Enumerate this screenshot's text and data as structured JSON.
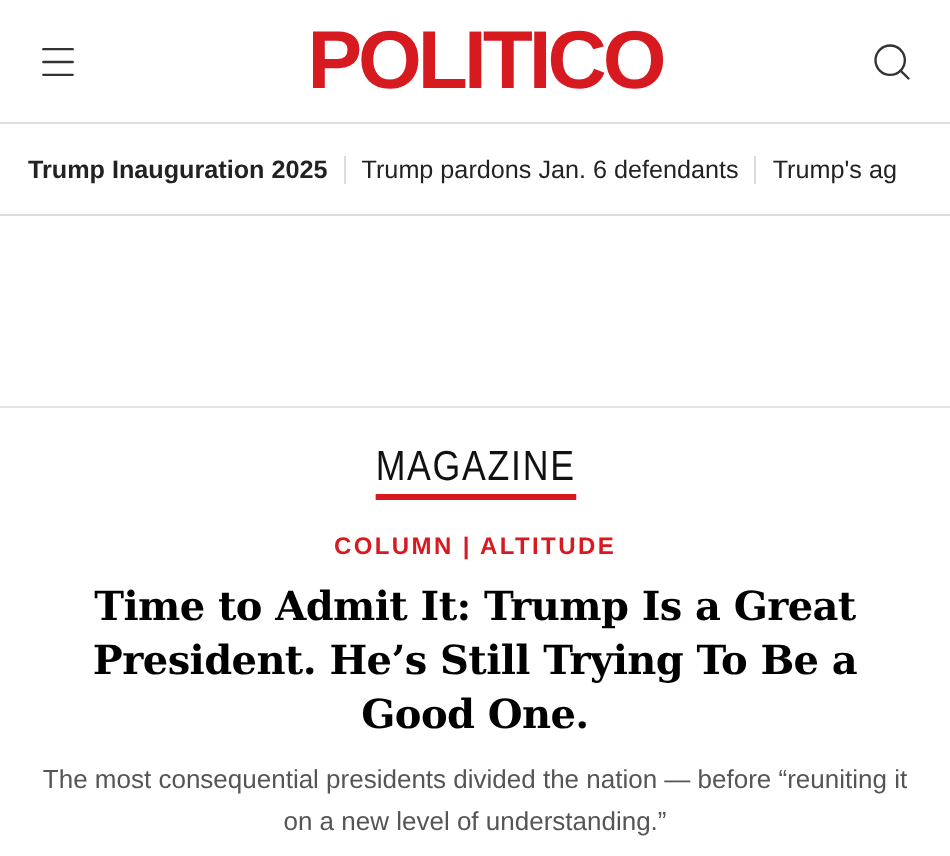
{
  "header": {
    "logo": "POLITICO"
  },
  "trending": [
    {
      "label": "Trump Inauguration 2025",
      "kind": "heading"
    },
    {
      "label": "Trump pardons Jan. 6 defendants",
      "kind": "link"
    },
    {
      "label": "Trump's ag",
      "kind": "link"
    }
  ],
  "article": {
    "section": "MAGAZINE",
    "kicker": "COLUMN | ALTITUDE",
    "headline": "Time to Admit It: Trump Is a Great President. He’s Still Trying To Be a Good One.",
    "dek": "The most consequential presidents divided the nation — before “reuniting it on a new level of understanding.”"
  }
}
